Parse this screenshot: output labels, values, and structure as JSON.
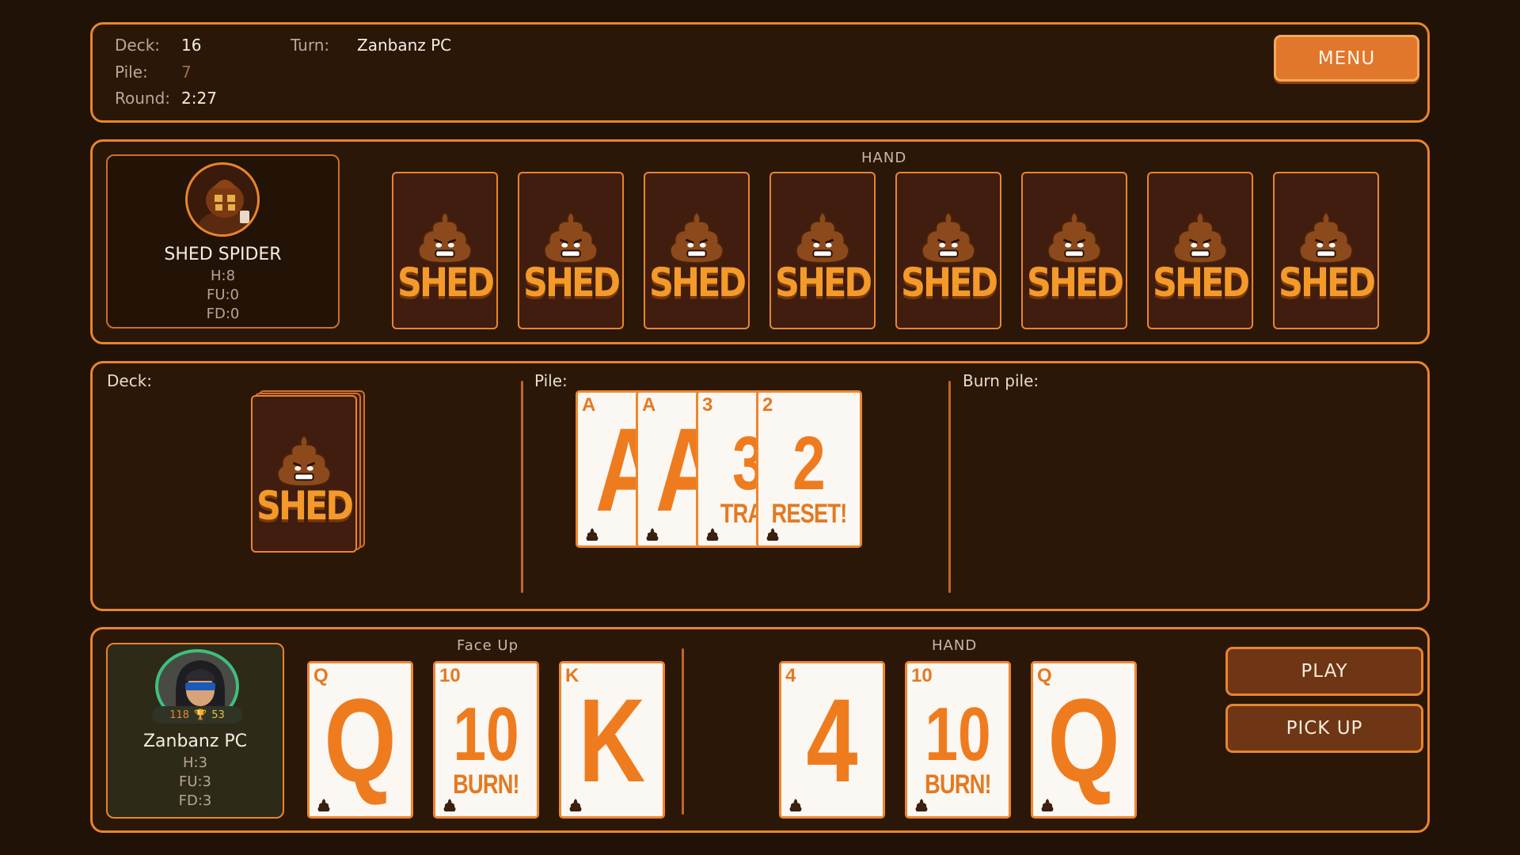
{
  "status": {
    "deck_label": "Deck:",
    "deck_value": "16",
    "pile_label": "Pile:",
    "pile_value": "7",
    "round_label": "Round:",
    "round_value": "2:27",
    "turn_label": "Turn:",
    "turn_value": "Zanbanz PC",
    "menu_label": "MENU"
  },
  "opponent": {
    "name": "SHED SPIDER",
    "hand_count": "H:8",
    "face_up": "FU:0",
    "face_down": "FD:0",
    "hand_label": "HAND",
    "card_back_text": "SHED",
    "hand_cards": 8
  },
  "table": {
    "deck_label": "Deck:",
    "deck_back_text": "SHED",
    "pile_label": "Pile:",
    "burn_label": "Burn pile:",
    "pile_cards": [
      {
        "rank": "A",
        "big": "A",
        "tag": ""
      },
      {
        "rank": "A",
        "big": "A",
        "tag": ""
      },
      {
        "rank": "3",
        "big": "3",
        "tag": "TRAN"
      },
      {
        "rank": "2",
        "big": "2",
        "tag": "RESET!"
      }
    ]
  },
  "player": {
    "name": "Zanbanz PC",
    "badge_coins": "118",
    "badge_trophies": "53",
    "hand_count": "H:3",
    "face_up": "FU:3",
    "face_down": "FD:3",
    "face_up_label": "Face Up",
    "hand_label": "HAND",
    "face_up_cards": [
      {
        "rank": "Q",
        "big": "Q",
        "tag": ""
      },
      {
        "rank": "10",
        "big": "10",
        "tag": "BURN!"
      },
      {
        "rank": "K",
        "big": "K",
        "tag": ""
      }
    ],
    "hand_cards": [
      {
        "rank": "4",
        "big": "4",
        "tag": ""
      },
      {
        "rank": "10",
        "big": "10",
        "tag": "BURN!"
      },
      {
        "rank": "Q",
        "big": "Q",
        "tag": ""
      }
    ],
    "play_label": "PLAY",
    "pickup_label": "PICK UP"
  },
  "colors": {
    "accent": "#e8852d",
    "card_orange": "#ee7c1f",
    "background": "#201206"
  }
}
